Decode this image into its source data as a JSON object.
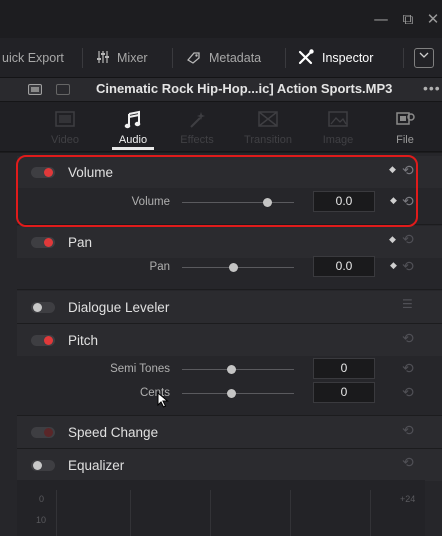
{
  "window": {
    "minimize_icon": "—",
    "restore_icon": "⧉",
    "close_icon": "✕"
  },
  "toolbar": {
    "quick_export": "uick Export",
    "mixer": "Mixer",
    "metadata": "Metadata",
    "inspector": "Inspector"
  },
  "clip": {
    "title": "Cinematic Rock Hip-Hop...ic] Action Sports.MP3",
    "menu": "•••"
  },
  "tabs": [
    {
      "label": "Video",
      "icon": "video-icon"
    },
    {
      "label": "Audio",
      "icon": "music-note-icon"
    },
    {
      "label": "Effects",
      "icon": "wand-icon"
    },
    {
      "label": "Transition",
      "icon": "transition-icon"
    },
    {
      "label": "Image",
      "icon": "image-icon"
    },
    {
      "label": "File",
      "icon": "file-icon"
    }
  ],
  "sections": {
    "volume": {
      "title": "Volume",
      "param_label": "Volume",
      "value": "0.0",
      "enabled": true
    },
    "pan": {
      "title": "Pan",
      "param_label": "Pan",
      "value": "0.0",
      "enabled": true
    },
    "dialogue": {
      "title": "Dialogue Leveler",
      "enabled": false
    },
    "pitch": {
      "title": "Pitch",
      "semitones_label": "Semi Tones",
      "semitones_value": "0",
      "cents_label": "Cents",
      "cents_value": "0",
      "enabled": true
    },
    "speed": {
      "title": "Speed Change",
      "enabled": false
    },
    "equalizer": {
      "title": "Equalizer",
      "enabled": false,
      "scale_left_top": "0",
      "scale_left_bottom": "10",
      "scale_right_top": "+24"
    }
  },
  "colors": {
    "accent_red": "#e0393a",
    "highlight_red": "#e01b1b",
    "background": "#26262a"
  }
}
